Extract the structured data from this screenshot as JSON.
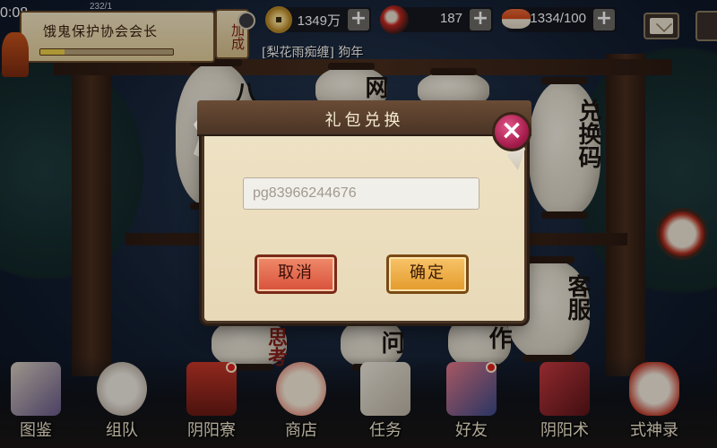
{
  "status": {
    "time": "0:08",
    "signal": "232/1"
  },
  "guild": {
    "title": "饿鬼保护协会会长",
    "progress": 0.18
  },
  "bonus_tag": "加成",
  "currencies": [
    {
      "name": "gold",
      "icon": "coin-icon",
      "value": "1349万"
    },
    {
      "name": "jade",
      "icon": "jade-icon",
      "value": "187"
    },
    {
      "name": "stamina",
      "icon": "sushi-icon",
      "value": "1334/100"
    }
  ],
  "chat": {
    "message": "[梨花雨痴缠] 狗年"
  },
  "lanterns": [
    {
      "text": "八"
    },
    {
      "text": "网"
    },
    {
      "text": "兑换码"
    },
    {
      "text": "客服"
    },
    {
      "text": "作"
    },
    {
      "text": "问"
    },
    {
      "text": "思考"
    }
  ],
  "dialog": {
    "title": "礼包兑换",
    "code_value": "pg83966244676",
    "cancel_label": "取消",
    "confirm_label": "确定",
    "close_label": "×"
  },
  "nav": [
    {
      "label": "图鉴",
      "icon": "scroll-icon",
      "color": "#d8cfc0"
    },
    {
      "label": "组队",
      "icon": "team-icon",
      "color": "#e6e0d6"
    },
    {
      "label": "阴阳寮",
      "icon": "shrine-icon",
      "color": "#b8322a"
    },
    {
      "label": "商店",
      "icon": "lucky-cat-icon",
      "color": "#f2e4cc"
    },
    {
      "label": "任务",
      "icon": "book-icon",
      "color": "#e8e2d6"
    },
    {
      "label": "好友",
      "icon": "friends-icon",
      "color": "#c84a5a"
    },
    {
      "label": "阴阳术",
      "icon": "spellbook-icon",
      "color": "#9a2a30"
    },
    {
      "label": "式神录",
      "icon": "fox-mask-icon",
      "color": "#e8ded0"
    }
  ]
}
